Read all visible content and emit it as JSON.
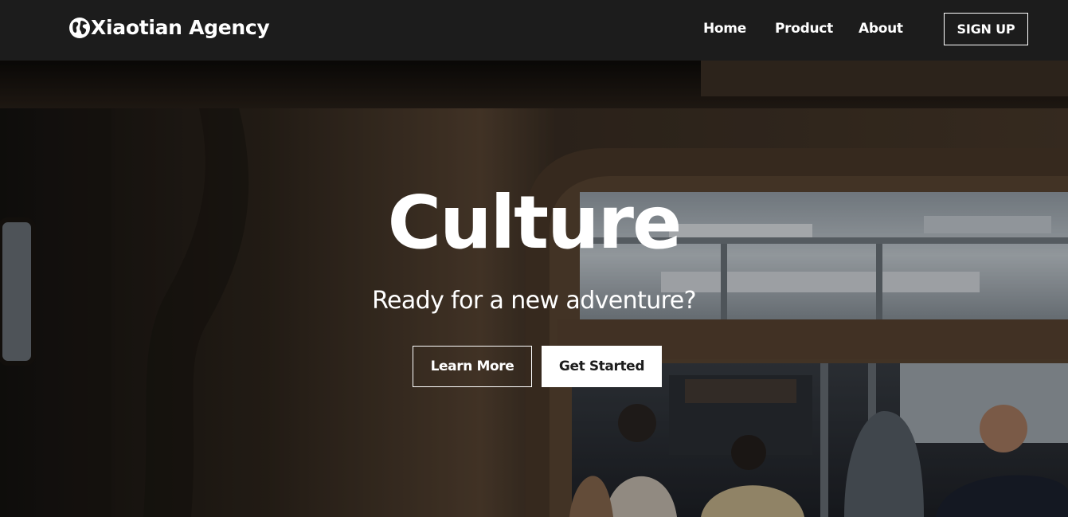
{
  "brand": {
    "name": "Xiaotian Agency",
    "icon": "globe-icon"
  },
  "nav": {
    "items": [
      {
        "label": "Home"
      },
      {
        "label": "Product"
      },
      {
        "label": "About"
      }
    ],
    "signup_label": "SIGN UP"
  },
  "hero": {
    "title": "Culture",
    "subtitle": "Ready for a new adventure?",
    "primary_button": "Learn More",
    "secondary_button": "Get Started"
  },
  "colors": {
    "navbar_bg": "#1c1c1c",
    "text": "#ffffff",
    "button_fill": "#ffffff",
    "button_text": "#1c1c1c"
  }
}
